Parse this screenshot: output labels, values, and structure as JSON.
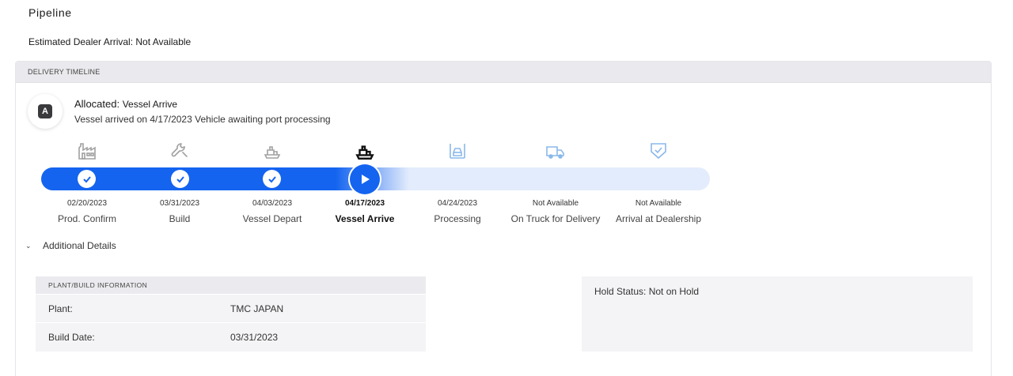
{
  "page": {
    "title": "Pipeline",
    "eta_label": "Estimated Dealer Arrival: Not Available"
  },
  "timeline": {
    "header": "DELIVERY TIMELINE",
    "status_badge": "A",
    "status_title": "Allocated:",
    "status_sub": "Vessel Arrive",
    "status_desc": "Vessel arrived on 4/17/2023 Vehicle awaiting port processing",
    "progress_fraction": 0.55,
    "steps": [
      {
        "date": "02/20/2023",
        "label": "Prod. Confirm",
        "state": "done",
        "icon": "factory-icon"
      },
      {
        "date": "03/31/2023",
        "label": "Build",
        "state": "done",
        "icon": "wrench-icon"
      },
      {
        "date": "04/03/2023",
        "label": "Vessel Depart",
        "state": "done",
        "icon": "ship-icon"
      },
      {
        "date": "04/17/2023",
        "label": "Vessel Arrive",
        "state": "current",
        "icon": "ship-icon"
      },
      {
        "date": "04/24/2023",
        "label": "Processing",
        "state": "pending",
        "icon": "car-inspection-icon"
      },
      {
        "date": "Not Available",
        "label": "On Truck for Delivery",
        "state": "pending",
        "icon": "truck-icon"
      },
      {
        "date": "Not Available",
        "label": "Arrival at Dealership",
        "state": "pending",
        "icon": "shield-check-icon"
      }
    ],
    "colors": {
      "accent": "#1464f0",
      "track": "#e3ecfc",
      "done_icon": "#9a9a9a",
      "pending_icon": "#8ab8ea"
    }
  },
  "details": {
    "toggle_label": "Additional Details",
    "plant_box": {
      "header": "PLANT/BUILD INFORMATION",
      "rows": [
        {
          "key": "Plant:",
          "value": "TMC JAPAN"
        },
        {
          "key": "Build Date:",
          "value": "03/31/2023"
        }
      ]
    },
    "hold_status": "Hold Status: Not on Hold"
  }
}
